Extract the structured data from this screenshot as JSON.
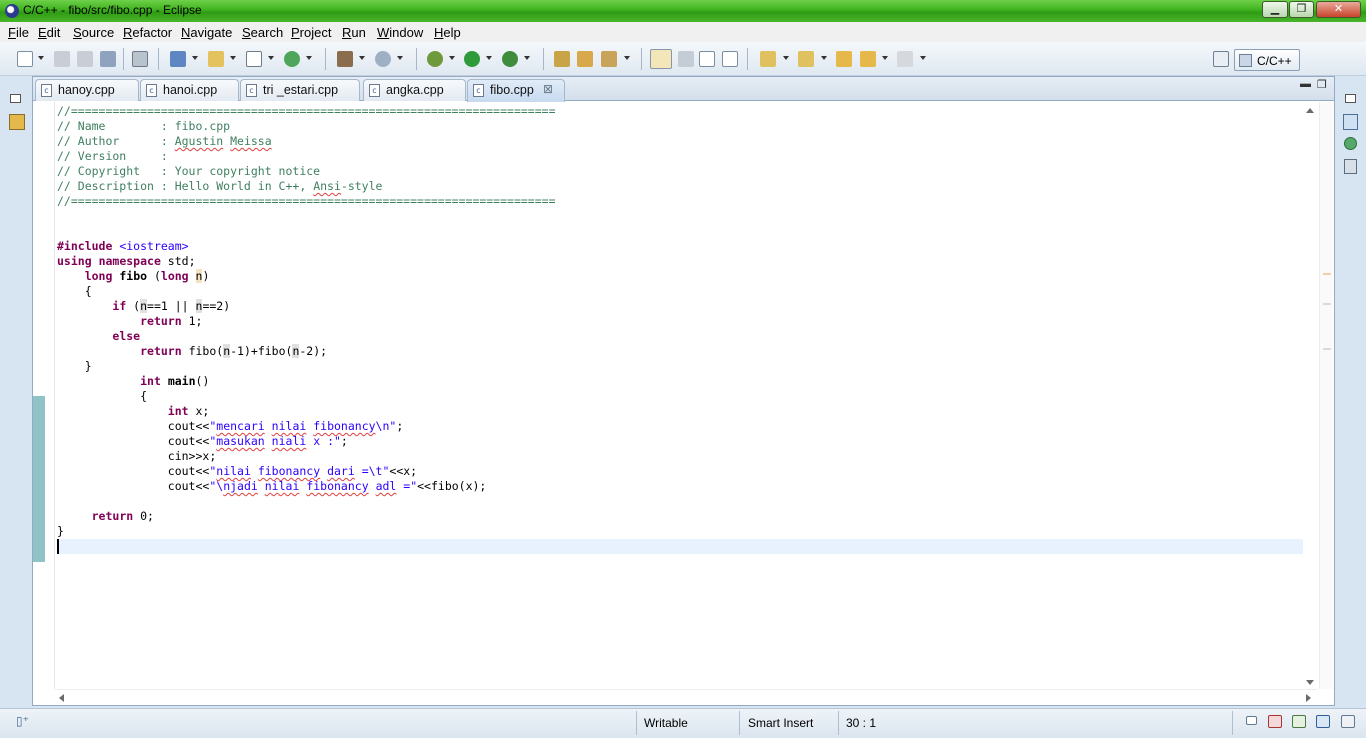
{
  "window": {
    "title": "C/C++ - fibo/src/fibo.cpp - Eclipse"
  },
  "menu": [
    "File",
    "Edit",
    "Source",
    "Refactor",
    "Navigate",
    "Search",
    "Project",
    "Run",
    "Window",
    "Help"
  ],
  "toolbar": {
    "perspective_label": "C/C++",
    "icons": [
      "new-icon",
      "save-icon",
      "save-all-icon",
      "print-icon",
      "binary-icon",
      "new-project-icon",
      "new-folder-icon",
      "new-class-icon",
      "new-file-icon",
      "build-icon",
      "build-config-icon",
      "debug-icon",
      "run-icon",
      "external-tools-icon",
      "open-type-icon",
      "open-element-icon",
      "search-icon",
      "mark-occurrences-icon",
      "toggle-highlight-icon",
      "show-whitespace-icon",
      "next-annotation-icon",
      "previous-annotation-icon",
      "last-edit-icon",
      "back-icon",
      "forward-icon",
      "open-perspective-icon"
    ]
  },
  "tabs": [
    {
      "label": "hanoy.cpp",
      "active": false
    },
    {
      "label": "hanoi.cpp",
      "active": false
    },
    {
      "label": "tri _estari.cpp",
      "active": false
    },
    {
      "label": "angka.cpp",
      "active": false
    },
    {
      "label": "fibo.cpp",
      "active": true
    }
  ],
  "editor": {
    "lines": [
      "//======================================================================",
      "// Name        : fibo.cpp",
      "// Author      : Agustin Meissa",
      "// Version     :",
      "// Copyright   : Your copyright notice",
      "// Description : Hello World in C++, Ansi-style",
      "//======================================================================",
      "",
      "",
      "#include <iostream>",
      "using namespace std;",
      "    long fibo (long n)",
      "    {",
      "        if (n==1 || n==2)",
      "            return 1;",
      "        else",
      "            return fibo(n-1)+fibo(n-2);",
      "    }",
      "            int main()",
      "            {",
      "                int x;",
      "                cout<<\"mencari nilai fibonancy\\n\";",
      "                cout<<\"masukan niali x :\";",
      "                cin>>x;",
      "                cout<<\"nilai fibonancy dari =\\t\"<<x;",
      "                cout<<\"\\njadi nilai fibonancy adl =\"<<fibo(x);",
      "",
      "     return 0;",
      "}",
      ""
    ],
    "current_line": 30
  },
  "status": {
    "writable": "Writable",
    "insert_mode": "Smart Insert",
    "position": "30 : 1"
  }
}
